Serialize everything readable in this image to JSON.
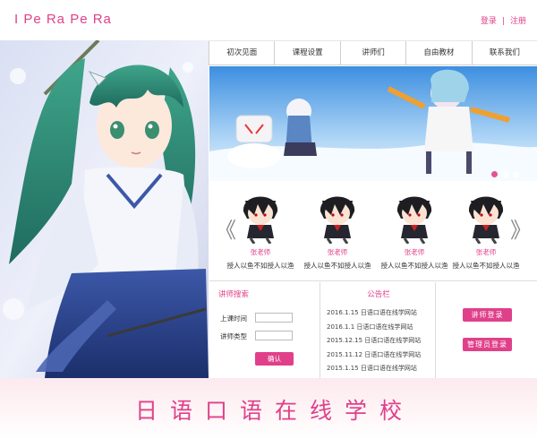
{
  "header": {
    "logo": "I Pe Ra Pe Ra",
    "login": "登录",
    "separator": "|",
    "register": "注册"
  },
  "nav": [
    "初次见面",
    "课程设置",
    "讲师们",
    "自由教材",
    "联系我们"
  ],
  "banner": {
    "slides": 3,
    "active_slide": 1
  },
  "teachers": {
    "prev": "《",
    "next": "》",
    "items": [
      {
        "name": "张老师",
        "desc": "授人以鱼不如授人以渔"
      },
      {
        "name": "张老师",
        "desc": "授人以鱼不如授人以渔"
      },
      {
        "name": "张老师",
        "desc": "授人以鱼不如授人以渔"
      },
      {
        "name": "张老师",
        "desc": "授人以鱼不如授人以渔"
      }
    ]
  },
  "search": {
    "title": "讲师搜索",
    "time_label": "上课时间",
    "type_label": "讲师类型",
    "submit": "确认"
  },
  "notice": {
    "title": "公告栏",
    "items": [
      "2016.1.15  日语口语在线学网站",
      "2016.1.1  日语口语在线学网站",
      "2015.12.15  日语口语在线学网站",
      "2015.11.12  日语口语在线学网站",
      "2015.1.15  日语口语在线学网站"
    ]
  },
  "logins": {
    "teacher": "讲师登录",
    "admin": "管理员登录"
  },
  "footer": {
    "title": "日语口语在线学校"
  },
  "colors": {
    "accent": "#e0408a"
  }
}
